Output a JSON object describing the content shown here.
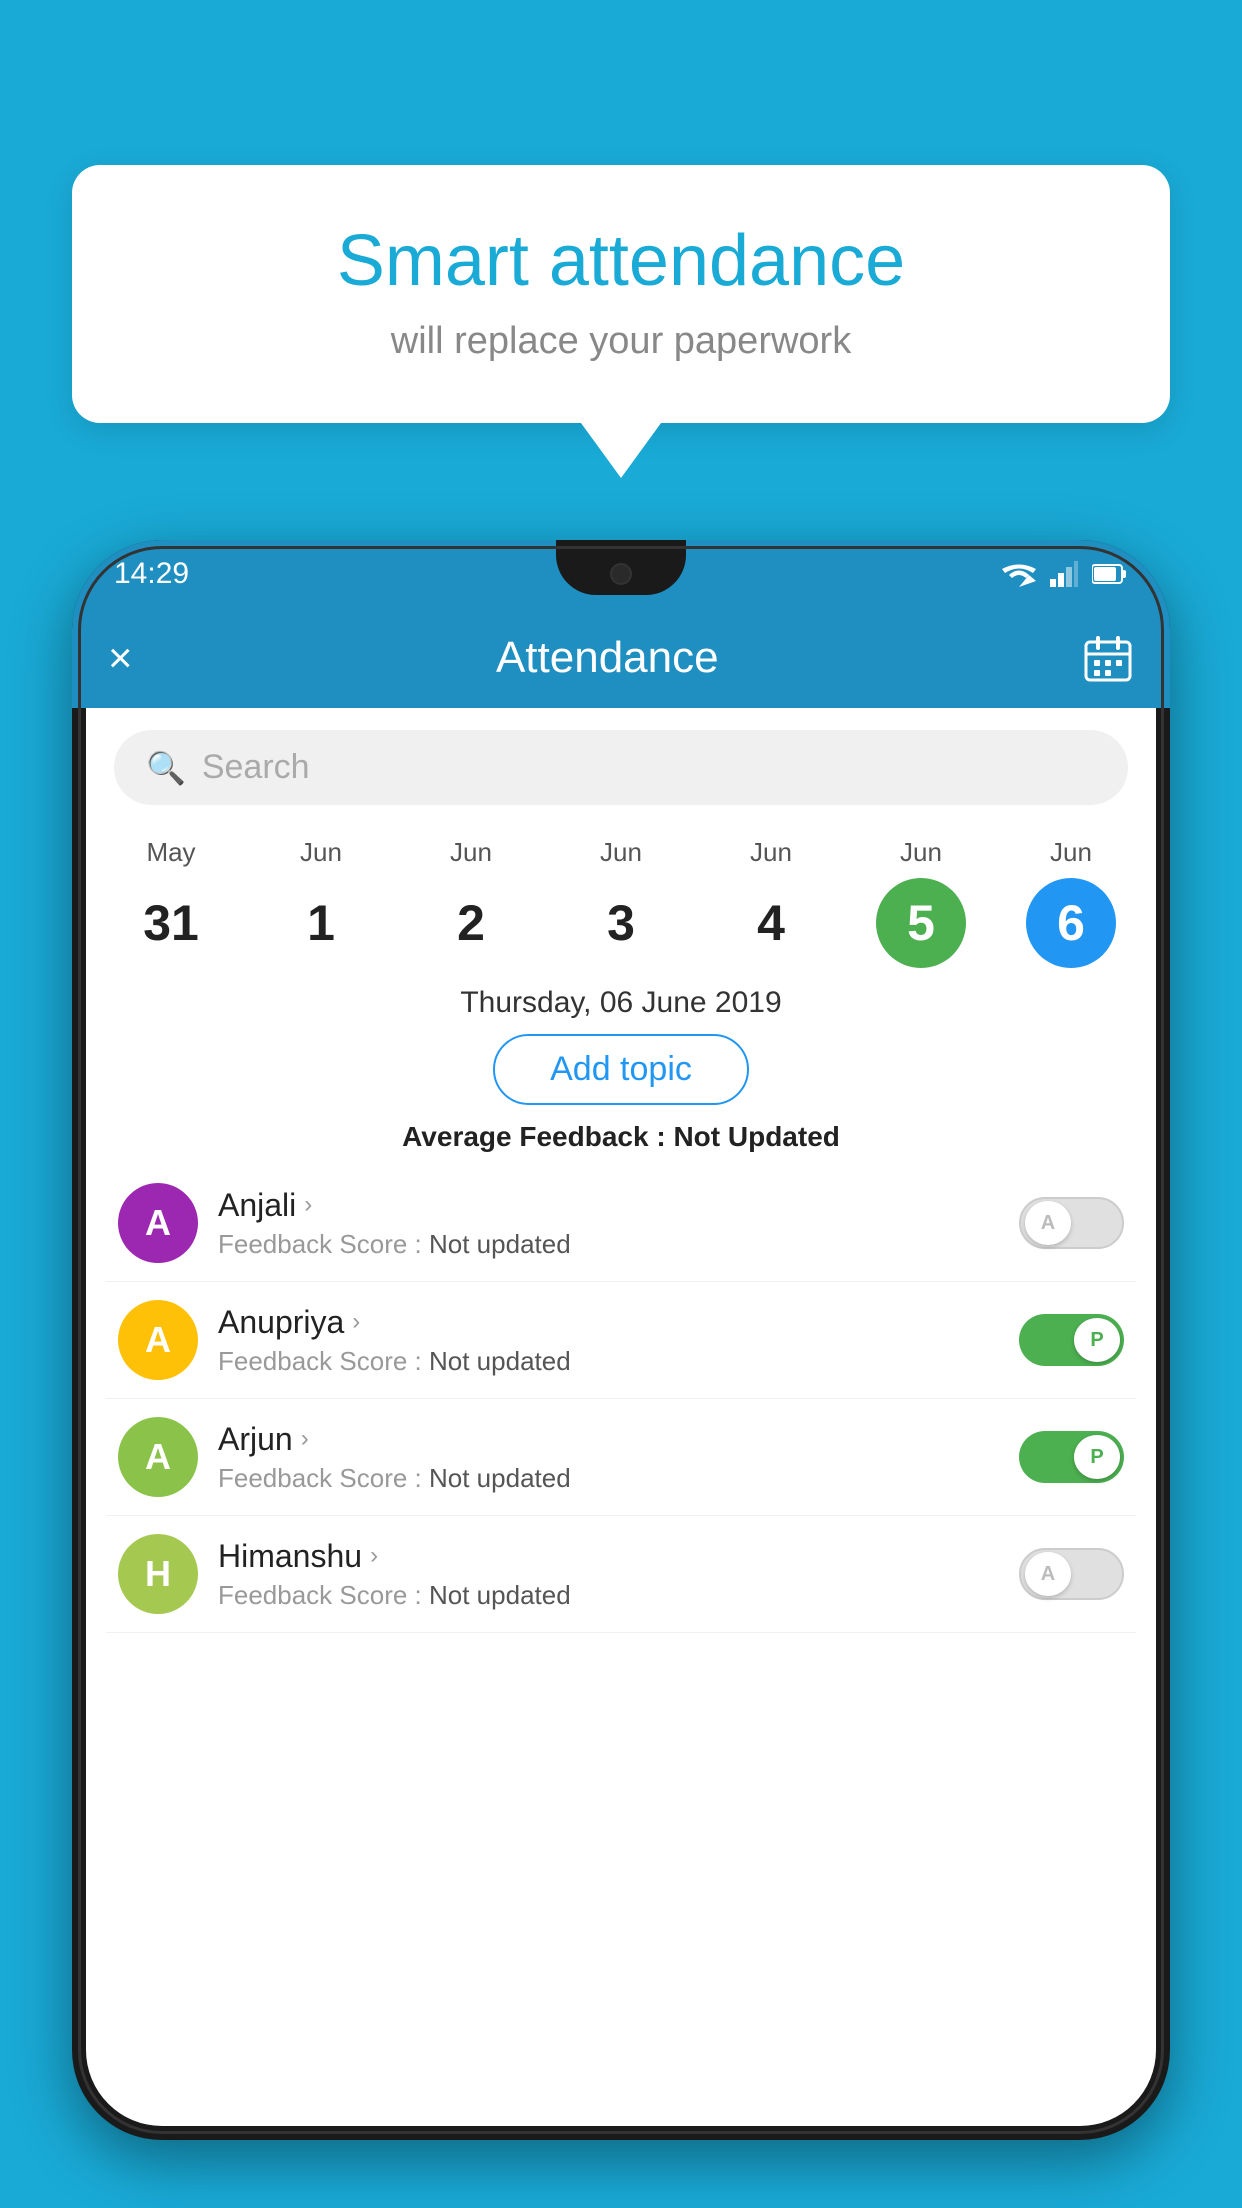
{
  "background": {
    "color": "#19aad6"
  },
  "speech_bubble": {
    "title": "Smart attendance",
    "subtitle": "will replace your paperwork"
  },
  "status_bar": {
    "time": "14:29"
  },
  "app_bar": {
    "title": "Attendance",
    "close_label": "×",
    "calendar_icon": "calendar"
  },
  "search": {
    "placeholder": "Search"
  },
  "calendar": {
    "days": [
      {
        "month": "May",
        "date": "31",
        "style": "normal"
      },
      {
        "month": "Jun",
        "date": "1",
        "style": "normal"
      },
      {
        "month": "Jun",
        "date": "2",
        "style": "normal"
      },
      {
        "month": "Jun",
        "date": "3",
        "style": "normal"
      },
      {
        "month": "Jun",
        "date": "4",
        "style": "normal"
      },
      {
        "month": "Jun",
        "date": "5",
        "style": "today"
      },
      {
        "month": "Jun",
        "date": "6",
        "style": "selected"
      }
    ]
  },
  "date_heading": "Thursday, 06 June 2019",
  "add_topic_label": "Add topic",
  "avg_feedback_label": "Average Feedback :",
  "avg_feedback_value": "Not Updated",
  "students": [
    {
      "name": "Anjali",
      "avatar_letter": "A",
      "avatar_color": "#9c27b0",
      "feedback_label": "Feedback Score :",
      "feedback_value": "Not updated",
      "toggle": "off",
      "toggle_letter": "A"
    },
    {
      "name": "Anupriya",
      "avatar_letter": "A",
      "avatar_color": "#ffc107",
      "feedback_label": "Feedback Score :",
      "feedback_value": "Not updated",
      "toggle": "on",
      "toggle_letter": "P"
    },
    {
      "name": "Arjun",
      "avatar_letter": "A",
      "avatar_color": "#8bc34a",
      "feedback_label": "Feedback Score :",
      "feedback_value": "Not updated",
      "toggle": "on",
      "toggle_letter": "P"
    },
    {
      "name": "Himanshu",
      "avatar_letter": "H",
      "avatar_color": "#a5c850",
      "feedback_label": "Feedback Score :",
      "feedback_value": "Not updated",
      "toggle": "off",
      "toggle_letter": "A"
    }
  ]
}
